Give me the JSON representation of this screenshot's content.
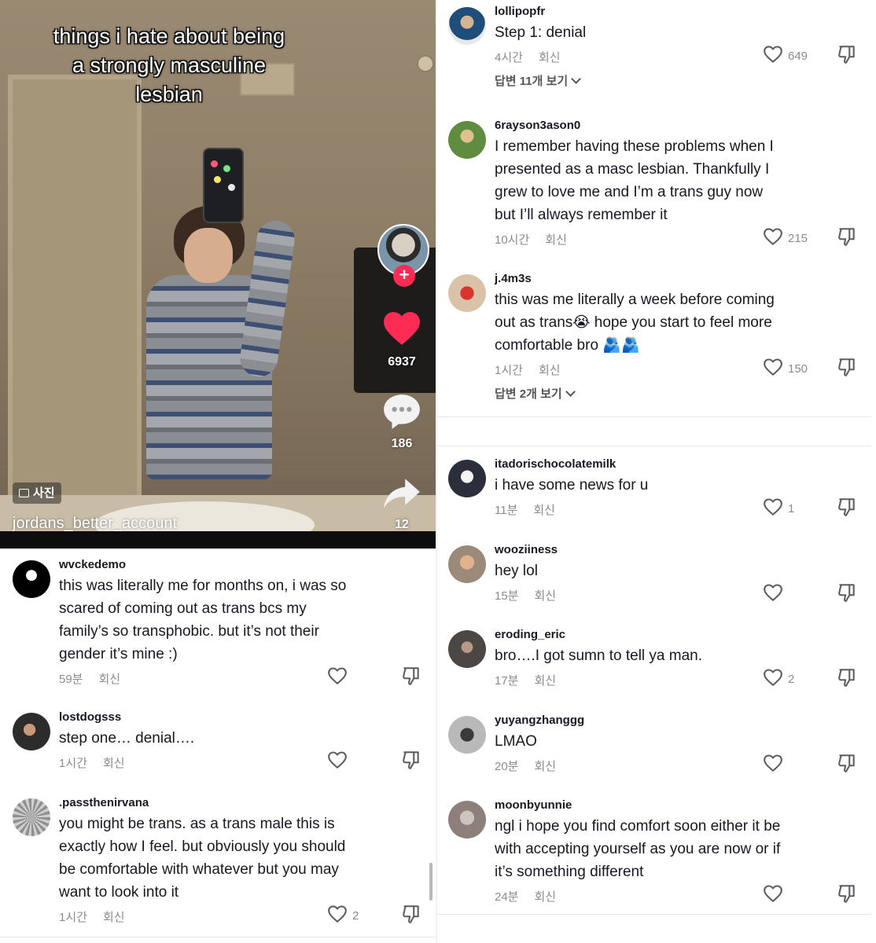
{
  "video": {
    "overlay_title_lines": [
      "things i hate about being",
      "a strongly masculine",
      "lesbian"
    ],
    "username": "jordans_better_account",
    "photo_badge": "사진",
    "like_count": "6937",
    "comment_count": "186",
    "share_count": "12",
    "accent_color": "#fe2c55"
  },
  "reply_label": "회신",
  "left_comments": [
    {
      "user": "wvckedemo",
      "lines": [
        "this was literally me for months on, i was so",
        "scared of coming out as trans bcs my",
        "family’s so transphobic. but it’s not their",
        "gender it’s mine :)"
      ],
      "time": "59분",
      "likes": ""
    },
    {
      "user": "lostdogsss",
      "lines": [
        "step one… denial…."
      ],
      "time": "1시간",
      "likes": ""
    },
    {
      "user": ".passthenirvana",
      "lines": [
        "you might be trans. as a trans male this is",
        "exactly how I feel. but obviously you should",
        "be comfortable with whatever but you may",
        "want to look into it"
      ],
      "time": "1시간",
      "likes": "2"
    }
  ],
  "right_comments": [
    {
      "user": "lollipopfr",
      "lines": [
        "Step 1: denial"
      ],
      "time": "4시간",
      "likes": "649",
      "view_replies": "답변 11개 보기"
    },
    {
      "user": "6rayson3ason0",
      "lines": [
        "I remember having these problems when I",
        "presented as a masc lesbian. Thankfully I",
        "grew to love me and I’m a trans guy now",
        "but I’ll always remember it"
      ],
      "time": "10시간",
      "likes": "215",
      "view_replies": ""
    },
    {
      "user": "j.4m3s",
      "lines": [
        "this was me literally a week before coming",
        "out as trans😭 hope you start to feel more",
        "comfortable bro 🫂🫂"
      ],
      "time": "1시간",
      "likes": "150",
      "view_replies": "답변 2개 보기"
    },
    {
      "user": "itadorischocolatemilk",
      "lines": [
        "i have some news for u"
      ],
      "time": "11분",
      "likes": "1",
      "view_replies": ""
    },
    {
      "user": "wooziiness",
      "lines": [
        "hey lol"
      ],
      "time": "15분",
      "likes": "",
      "view_replies": ""
    },
    {
      "user": "eroding_eric",
      "lines": [
        "bro….I got sumn to tell ya man."
      ],
      "time": "17분",
      "likes": "2",
      "view_replies": ""
    },
    {
      "user": "yuyangzhanggg",
      "lines": [
        "LMAO"
      ],
      "time": "20분",
      "likes": "",
      "view_replies": ""
    },
    {
      "user": "moonbyunnie",
      "lines": [
        "ngl i hope you find comfort soon either it be",
        "with accepting yourself as you are now or if",
        "it’s something different"
      ],
      "time": "24분",
      "likes": "",
      "view_replies": ""
    }
  ]
}
